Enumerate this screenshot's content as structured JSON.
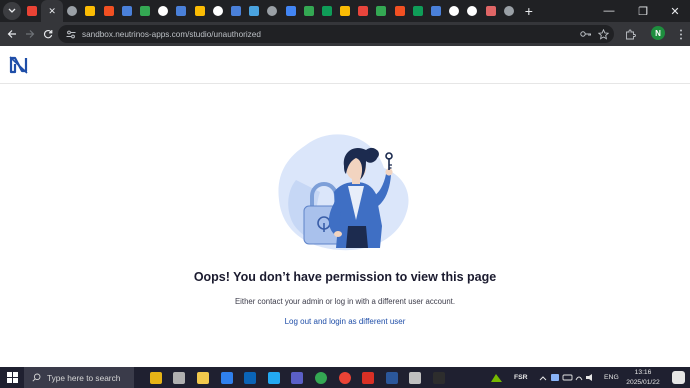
{
  "browser": {
    "active_tab_close": "✕",
    "new_tab": "+",
    "window_minimize": "—",
    "window_restore": "❐",
    "window_close": "✕",
    "url": "sandbox.neutrinos-apps.com/studio/unauthorized",
    "profile_initial": "N",
    "tabs": [
      {
        "icon": "gmail-icon",
        "color": "#ea4335"
      },
      {
        "icon": "close-icon",
        "color": "#e8eaed"
      },
      {
        "icon": "chrome-icon",
        "color": "#9aa0a6"
      },
      {
        "icon": "drive-icon",
        "color": "#fbbc04"
      },
      {
        "icon": "microsoft-icon",
        "color": "#f25022"
      },
      {
        "icon": "neutrinos-icon",
        "color": "#4a80d9"
      },
      {
        "icon": "drive-icon",
        "color": "#34a853"
      },
      {
        "icon": "google-icon",
        "color": "#ffffff"
      },
      {
        "icon": "neutrinos-icon",
        "color": "#4a80d9"
      },
      {
        "icon": "drive-icon",
        "color": "#fbbc04"
      },
      {
        "icon": "google-icon",
        "color": "#ffffff"
      },
      {
        "icon": "neutrinos-icon",
        "color": "#4a80d9"
      },
      {
        "icon": "app-icon",
        "color": "#4aa3df"
      },
      {
        "icon": "chrome-icon",
        "color": "#9aa0a6"
      },
      {
        "icon": "docs-icon",
        "color": "#4285f4"
      },
      {
        "icon": "drive-icon",
        "color": "#34a853"
      },
      {
        "icon": "sheets-icon",
        "color": "#0f9d58"
      },
      {
        "icon": "drive-icon",
        "color": "#fbbc04"
      },
      {
        "icon": "app-icon",
        "color": "#e8453c"
      },
      {
        "icon": "drive-icon",
        "color": "#34a853"
      },
      {
        "icon": "microsoft-icon",
        "color": "#f25022"
      },
      {
        "icon": "sheets-icon",
        "color": "#0f9d58"
      },
      {
        "icon": "neutrinos-icon",
        "color": "#4a80d9"
      },
      {
        "icon": "github-icon",
        "color": "#ffffff"
      },
      {
        "icon": "google-icon",
        "color": "#ffffff"
      },
      {
        "icon": "app-icon",
        "color": "#e06666"
      },
      {
        "icon": "chrome-icon",
        "color": "#9aa0a6"
      }
    ]
  },
  "page": {
    "title": "Oops! You don’t have permission to view this page",
    "subtitle": "Either contact your admin or log in with a different user account.",
    "link": "Log out and login as different user"
  },
  "taskbar": {
    "search_placeholder": "Type here to search",
    "tray_fsr": "FSR",
    "tray_lang": "ENG",
    "time": "13:16",
    "date": "2025/01/22",
    "apps": [
      {
        "icon": "explorer-folder-icon",
        "color": "#e7b416"
      },
      {
        "icon": "task-view-icon",
        "color": "#b0b0b0"
      },
      {
        "icon": "file-explorer-icon",
        "color": "#f2c94c"
      },
      {
        "icon": "store-icon",
        "color": "#2f80ed"
      },
      {
        "icon": "outlook-icon",
        "color": "#0a64b6"
      },
      {
        "icon": "vscode-icon",
        "color": "#23a9f2"
      },
      {
        "icon": "teams-icon",
        "color": "#5b5fc7"
      },
      {
        "icon": "chrome-icon",
        "color": "#34a853"
      },
      {
        "icon": "chrome-icon",
        "color": "#ea4335"
      },
      {
        "icon": "app-icon",
        "color": "#d93025"
      },
      {
        "icon": "word-icon",
        "color": "#2b579a"
      },
      {
        "icon": "settings-icon",
        "color": "#c0c0c0"
      },
      {
        "icon": "terminal-icon",
        "color": "#2d2d2d"
      }
    ]
  }
}
